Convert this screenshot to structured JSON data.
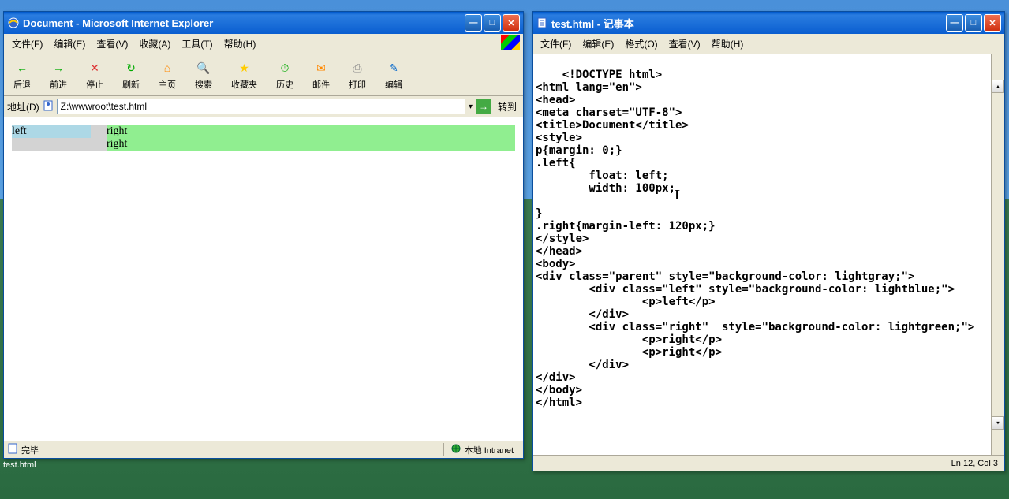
{
  "ie": {
    "title": "Document - Microsoft Internet Explorer",
    "menus": [
      "文件(F)",
      "编辑(E)",
      "查看(V)",
      "收藏(A)",
      "工具(T)",
      "帮助(H)"
    ],
    "toolbar": [
      {
        "label": "后退",
        "icon": "←",
        "color": "#0a0"
      },
      {
        "label": "前进",
        "icon": "→",
        "color": "#0a0"
      },
      {
        "label": "停止",
        "icon": "✕",
        "color": "#d33"
      },
      {
        "label": "刷新",
        "icon": "↻",
        "color": "#0a0"
      },
      {
        "label": "主页",
        "icon": "⌂",
        "color": "#f80"
      },
      {
        "label": "搜索",
        "icon": "🔍",
        "color": "#06c"
      },
      {
        "label": "收藏夹",
        "icon": "★",
        "color": "#fc0"
      },
      {
        "label": "历史",
        "icon": "⏱",
        "color": "#0a0"
      },
      {
        "label": "邮件",
        "icon": "✉",
        "color": "#f80"
      },
      {
        "label": "打印",
        "icon": "⎙",
        "color": "#888"
      },
      {
        "label": "编辑",
        "icon": "✎",
        "color": "#06c"
      }
    ],
    "addr_label": "地址(D)",
    "addr_value": "Z:\\wwwroot\\test.html",
    "go_label": "转到",
    "status_done": "完毕",
    "status_zone": "本地 Intranet",
    "page": {
      "left_text": "left",
      "right1": "right",
      "right2": "right"
    }
  },
  "notepad": {
    "title": "test.html - 记事本",
    "menus": [
      "文件(F)",
      "编辑(E)",
      "格式(O)",
      "查看(V)",
      "帮助(H)"
    ],
    "content": "<!DOCTYPE html>\n<html lang=\"en\">\n<head>\n<meta charset=\"UTF-8\">\n<title>Document</title>\n<style>\np{margin: 0;}\n.left{\n        float: left;\n        width: 100px;\n\n}\n.right{margin-left: 120px;}\n</style>\n</head>\n<body>\n<div class=\"parent\" style=\"background-color: lightgray;\">\n        <div class=\"left\" style=\"background-color: lightblue;\">\n                <p>left</p>\n        </div>\n        <div class=\"right\"  style=\"background-color: lightgreen;\">\n                <p>right</p>\n                <p>right</p>\n        </div>\n</div>\n</body>\n</html>",
    "status": "Ln 12, Col 3"
  },
  "taskbar_file": "test.html"
}
